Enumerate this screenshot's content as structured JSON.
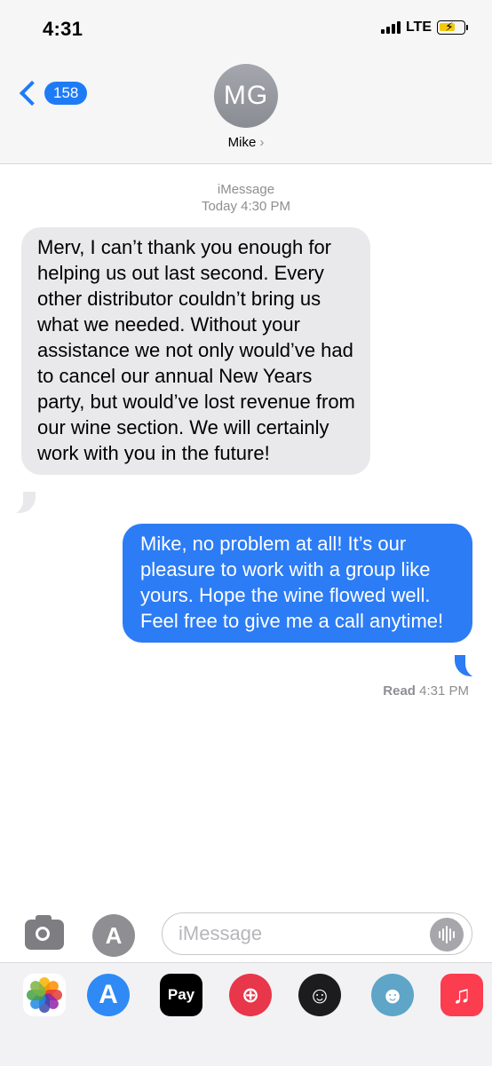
{
  "status": {
    "time": "4:31",
    "network": "LTE"
  },
  "nav": {
    "back_count": "158"
  },
  "contact": {
    "initials": "MG",
    "name": "Mike",
    "arrow": "›"
  },
  "thread": {
    "service": "iMessage",
    "timestamp": "Today 4:30 PM",
    "messages": [
      {
        "direction": "incoming",
        "text": "Merv, I can’t thank you enough for helping us out last second. Every other distributor couldn’t bring us what we needed. Without your assistance we not only would’ve had to cancel our annual New Years party, but would’ve lost revenue from our wine section.  We will certainly work with you in the future!"
      },
      {
        "direction": "outgoing",
        "text": "Mike, no problem at all!  It’s our pleasure to work with a group like yours.  Hope the wine flowed well.  Feel free to give me a call anytime!"
      }
    ],
    "receipt_label": "Read",
    "receipt_time": "4:31 PM"
  },
  "composer": {
    "placeholder": "iMessage"
  },
  "drawer": {
    "apps": [
      {
        "name": "photos-app-icon"
      },
      {
        "name": "app-store-icon"
      },
      {
        "name": "apple-pay-icon",
        "label": "Pay"
      },
      {
        "name": "web-search-icon"
      },
      {
        "name": "memoji-icon"
      },
      {
        "name": "memoji-stickers-icon"
      },
      {
        "name": "music-app-icon"
      }
    ]
  },
  "colors": {
    "accent": "#1e7bf6",
    "outgoing_bubble": "#2c7cf5",
    "incoming_bubble": "#e9e9eb"
  }
}
